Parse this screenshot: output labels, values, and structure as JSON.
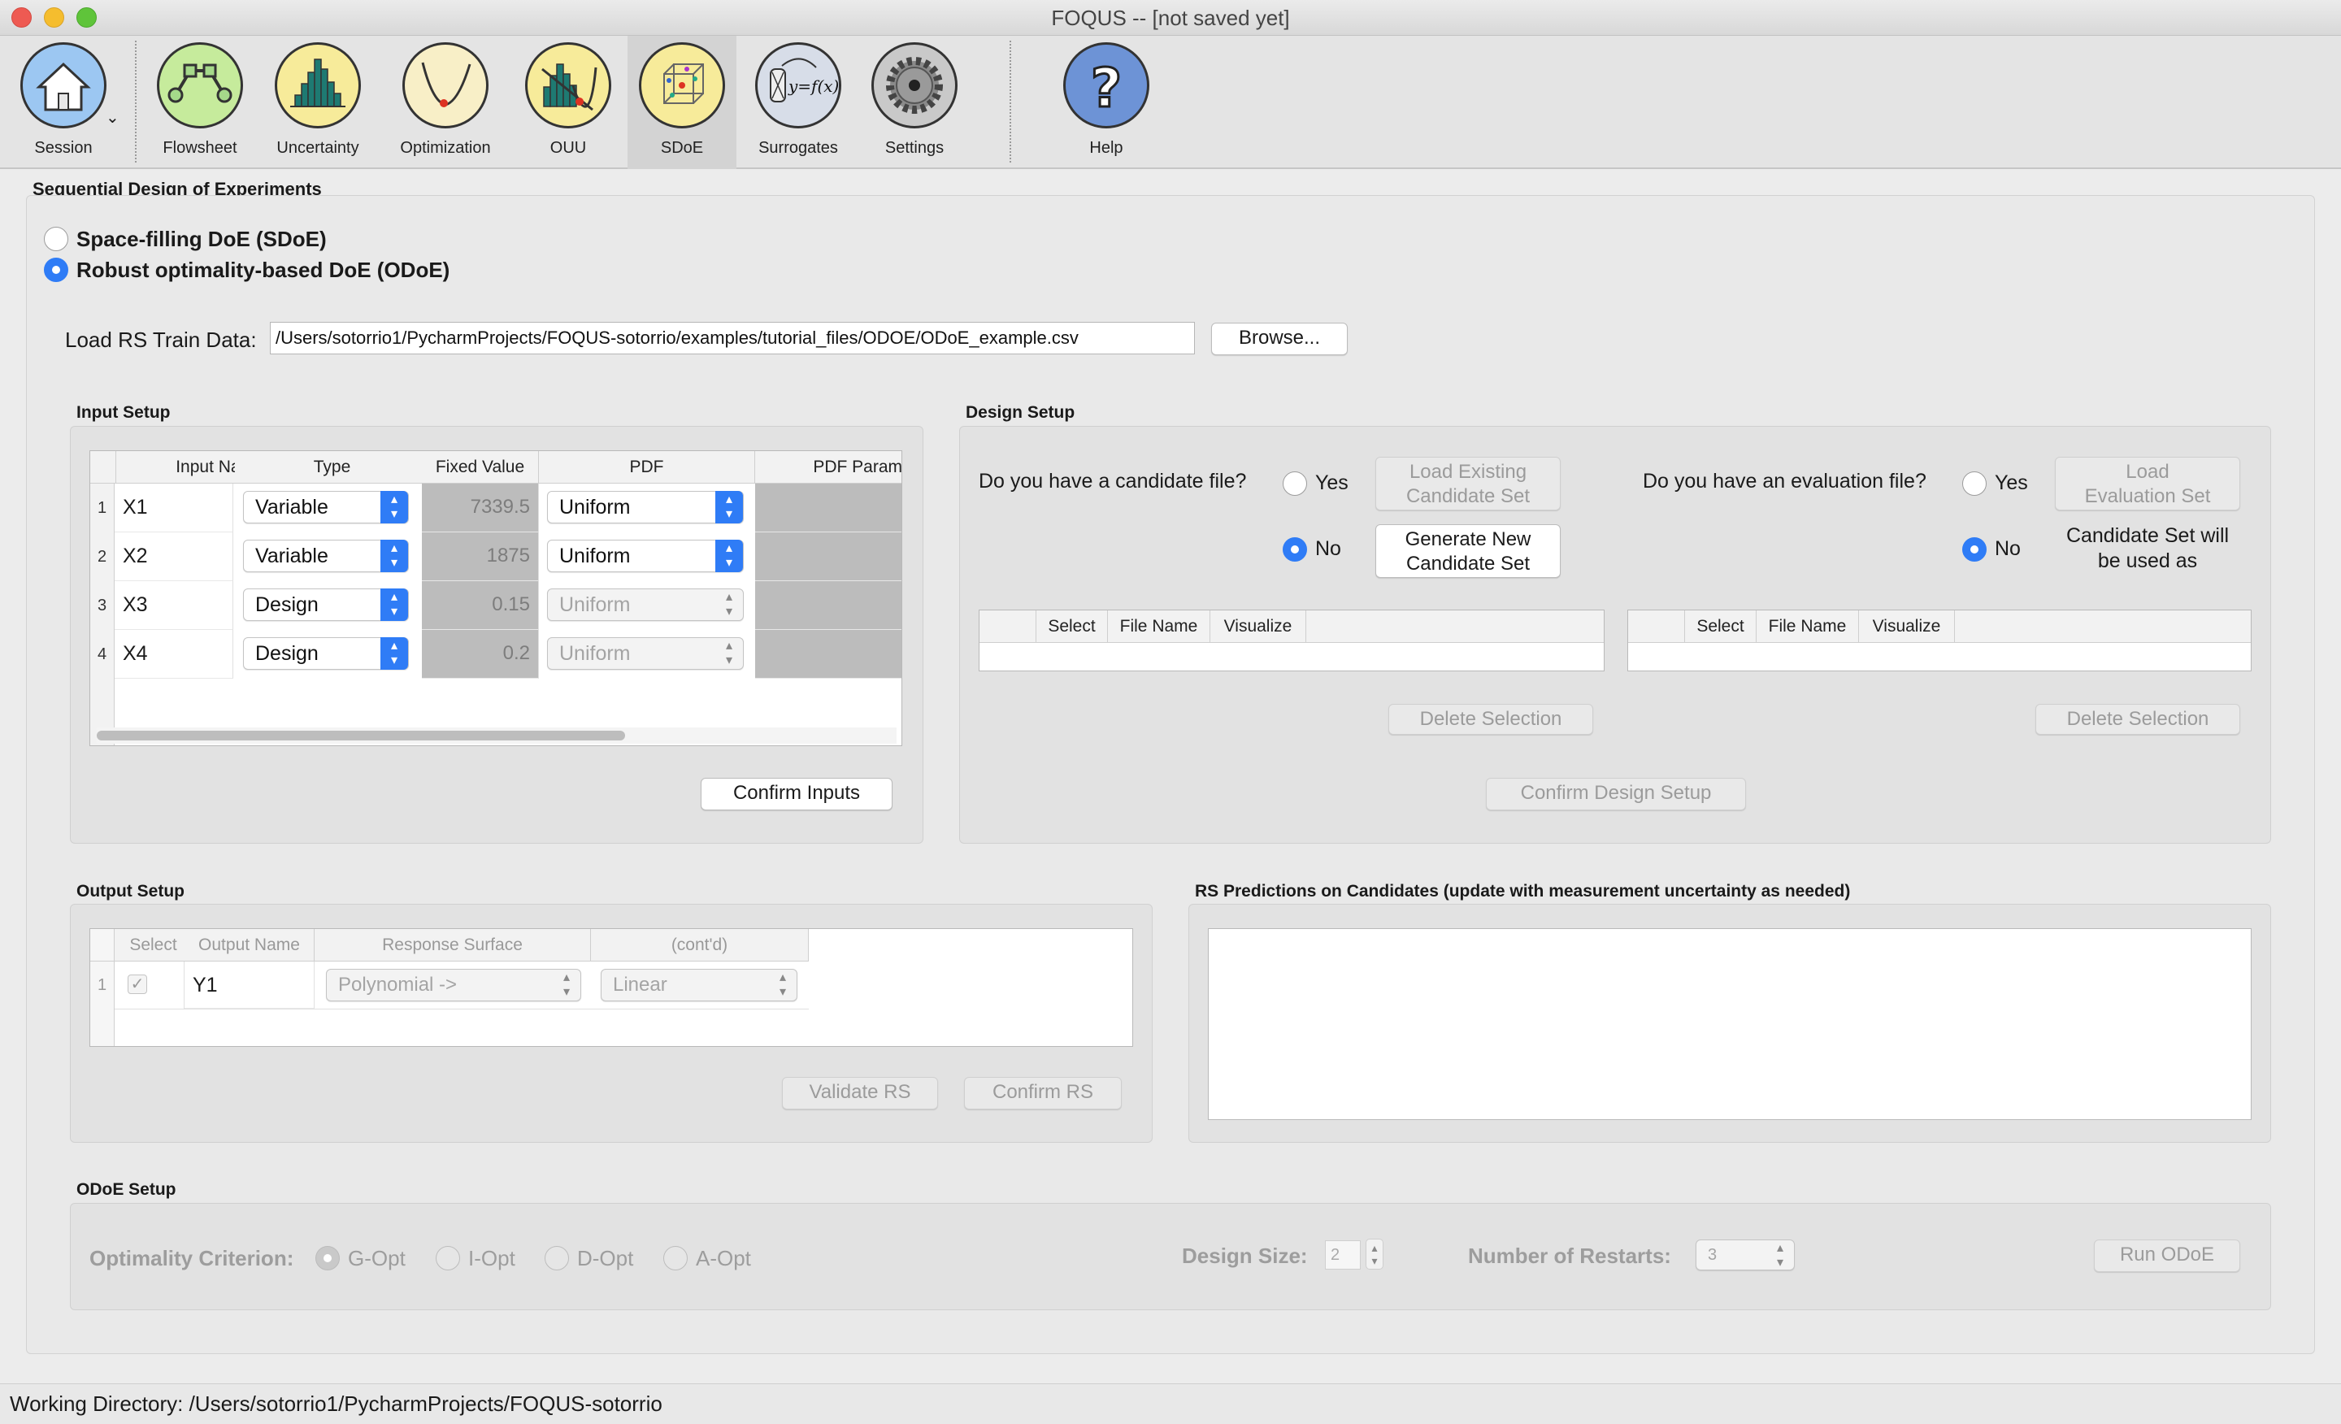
{
  "window": {
    "title": "FOQUS -- [not saved yet]"
  },
  "toolbar": {
    "items": [
      {
        "label": "Session"
      },
      {
        "label": "Flowsheet"
      },
      {
        "label": "Uncertainty"
      },
      {
        "label": "Optimization"
      },
      {
        "label": "OUU"
      },
      {
        "label": "SDoE"
      },
      {
        "label": "Surrogates"
      },
      {
        "label": "Settings"
      },
      {
        "label": "Help"
      }
    ],
    "active": "SDoE",
    "accent_color": "#2f7cf6"
  },
  "page": {
    "title": "Sequential Design of Experiments",
    "modes": [
      {
        "label": "Space-filling DoE (SDoE)",
        "checked": false
      },
      {
        "label": "Robust optimality-based DoE (ODoE)",
        "checked": true
      }
    ],
    "load_rs": {
      "label": "Load RS Train Data:",
      "value": "/Users/sotorrio1/PycharmProjects/FOQUS-sotorrio/examples/tutorial_files/ODOE/ODoE_example.csv",
      "browse": "Browse..."
    }
  },
  "input_setup": {
    "title": "Input Setup",
    "columns": [
      "Input Name",
      "Type",
      "Fixed Value",
      "PDF",
      "PDF Param"
    ],
    "rows": [
      {
        "n": "1",
        "name": "X1",
        "type": "Variable",
        "fixed": "7339.5",
        "pdf": "Uniform"
      },
      {
        "n": "2",
        "name": "X2",
        "type": "Variable",
        "fixed": "1875",
        "pdf": "Uniform"
      },
      {
        "n": "3",
        "name": "X3",
        "type": "Design",
        "fixed": "0.15",
        "pdf": "Uniform"
      },
      {
        "n": "4",
        "name": "X4",
        "type": "Design",
        "fixed": "0.2",
        "pdf": "Uniform"
      }
    ],
    "confirm": "Confirm Inputs"
  },
  "design_setup": {
    "title": "Design Setup",
    "candidate_q": "Do you have a candidate file?",
    "eval_q": "Do you have an evaluation file?",
    "yes": "Yes",
    "no": "No",
    "load_candidate": [
      "Load Existing",
      "Candidate Set"
    ],
    "generate_candidate": [
      "Generate New",
      "Candidate Set"
    ],
    "load_eval": [
      "Load",
      "Evaluation Set"
    ],
    "eval_note": [
      "Candidate Set will",
      "be used as"
    ],
    "table_cols": [
      "Select",
      "File Name",
      "Visualize"
    ],
    "delete": "Delete Selection",
    "confirm": "Confirm Design Setup"
  },
  "output_setup": {
    "title": "Output Setup",
    "columns": [
      "Select",
      "Output Name",
      "Response Surface",
      "(cont'd)"
    ],
    "rows": [
      {
        "n": "1",
        "checked": true,
        "name": "Y1",
        "rs": "Polynomial ->",
        "rs2": "Linear"
      }
    ],
    "validate": "Validate RS",
    "confirm": "Confirm RS"
  },
  "rs_predictions": {
    "title": "RS Predictions on Candidates (update with measurement uncertainty as needed)"
  },
  "odoe_setup": {
    "title": "ODoE Setup",
    "criterion_label": "Optimality Criterion:",
    "criteria": [
      {
        "label": "G-Opt",
        "checked": true
      },
      {
        "label": "I-Opt",
        "checked": false
      },
      {
        "label": "D-Opt",
        "checked": false
      },
      {
        "label": "A-Opt",
        "checked": false
      }
    ],
    "design_size_label": "Design Size:",
    "design_size": "2",
    "restarts_label": "Number of Restarts:",
    "restarts": "3",
    "run": "Run ODoE"
  },
  "status_bar": {
    "text": "Working Directory: /Users/sotorrio1/PycharmProjects/FOQUS-sotorrio"
  }
}
